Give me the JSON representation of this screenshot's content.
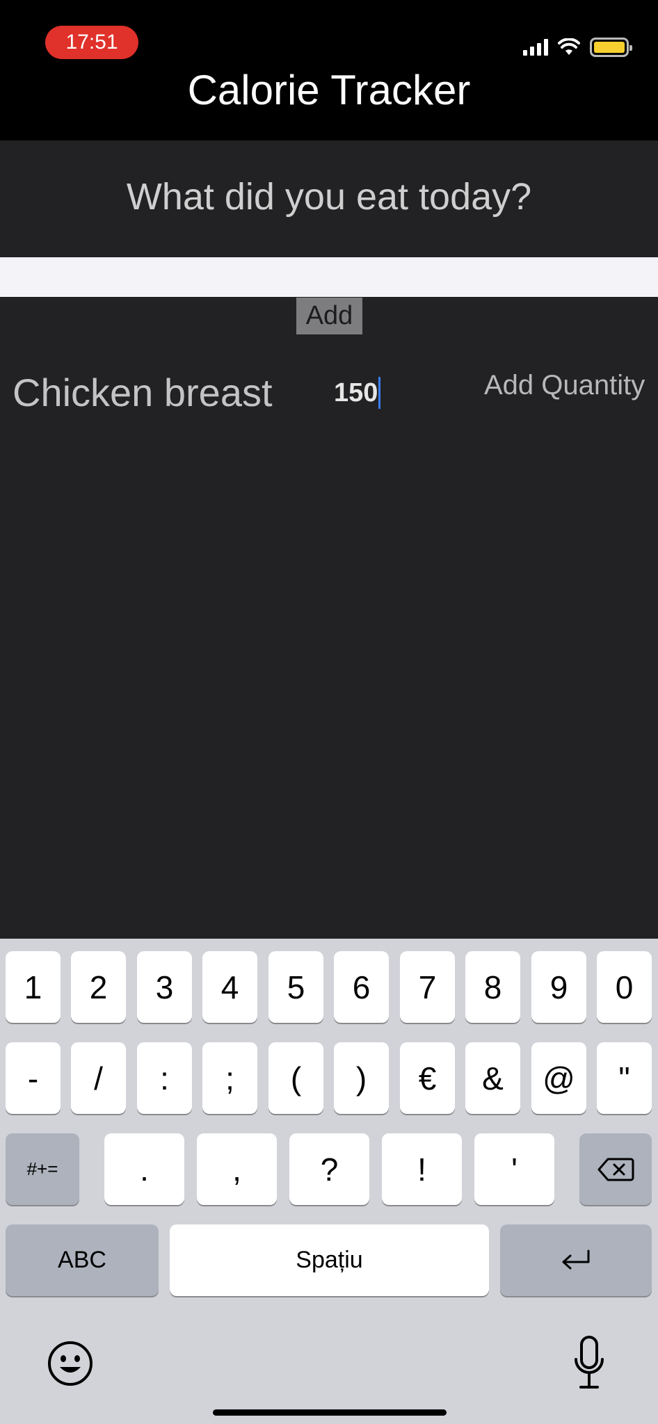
{
  "status_bar": {
    "time": "17:51",
    "icons": [
      "cellular-signal-icon",
      "wifi-icon",
      "battery-icon"
    ],
    "time_pill_color": "#e0312a",
    "battery_color": "#f7cf2f"
  },
  "header": {
    "title": "Calorie Tracker"
  },
  "main": {
    "question": "What did you eat today?",
    "food_input": {
      "value": "",
      "placeholder": ""
    },
    "add_button_label": "Add",
    "entry": {
      "food_name": "Chicken breast",
      "quantity_value": "150",
      "add_quantity_label": "Add Quantity"
    }
  },
  "keyboard": {
    "row1": [
      "1",
      "2",
      "3",
      "4",
      "5",
      "6",
      "7",
      "8",
      "9",
      "0"
    ],
    "row2": [
      "-",
      "/",
      ":",
      ";",
      "(",
      ")",
      "€",
      "&",
      "@",
      "\""
    ],
    "row3": {
      "shift_label": "#+=",
      "keys": [
        ".",
        ",",
        "?",
        "!",
        "'"
      ],
      "delete_icon": "backspace-icon"
    },
    "row4": {
      "abc_label": "ABC",
      "space_label": "Spațiu",
      "return_icon": "return-icon"
    },
    "bottom": {
      "left_icon": "emoji-icon",
      "right_icon": "microphone-icon"
    }
  }
}
